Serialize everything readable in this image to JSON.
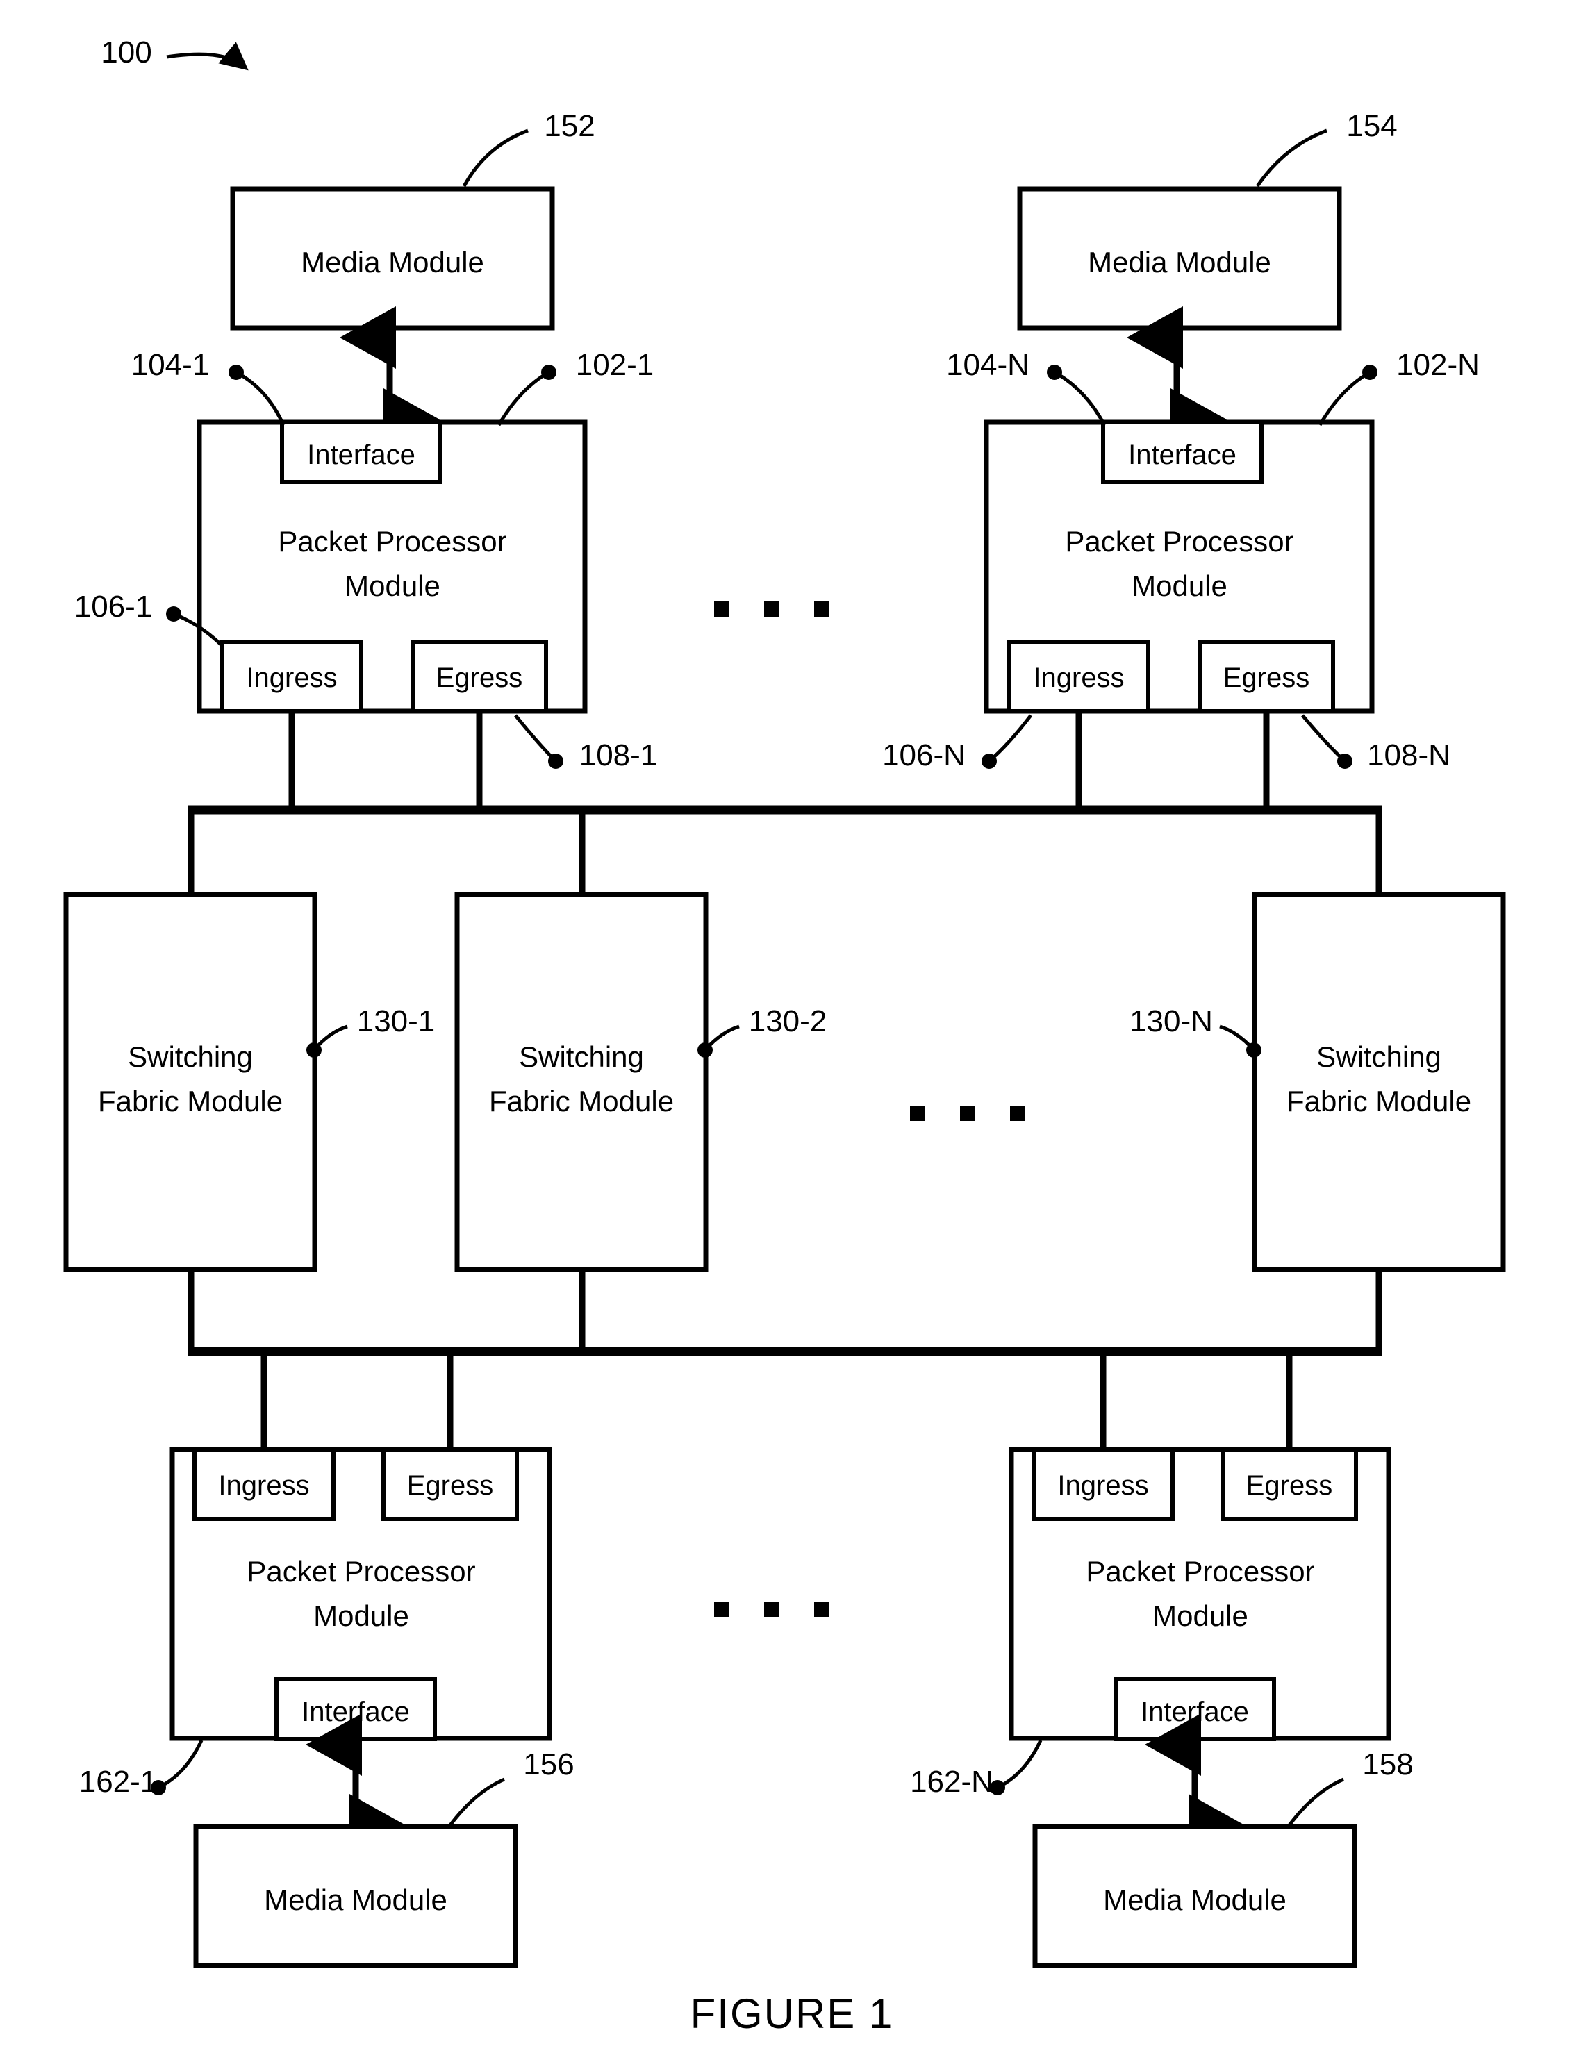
{
  "figure": {
    "caption": "FIGURE 1",
    "system_ref": "100"
  },
  "top_row": {
    "ellipsis": "• • •",
    "columns": [
      {
        "media_module": {
          "label": "Media Module",
          "ref": "152"
        },
        "packet_processor": {
          "label_line1": "Packet Processor",
          "label_line2": "Module",
          "ref": "102-1",
          "interface": {
            "label": "Interface",
            "ref": "104-1"
          },
          "ingress": {
            "label": "Ingress",
            "ref": "106-1"
          },
          "egress": {
            "label": "Egress",
            "ref": "108-1"
          }
        }
      },
      {
        "media_module": {
          "label": "Media Module",
          "ref": "154"
        },
        "packet_processor": {
          "label_line1": "Packet Processor",
          "label_line2": "Module",
          "ref": "102-N",
          "interface": {
            "label": "Interface",
            "ref": "104-N"
          },
          "ingress": {
            "label": "Ingress",
            "ref": "106-N"
          },
          "egress": {
            "label": "Egress",
            "ref": "108-N"
          }
        }
      }
    ]
  },
  "fabric_row": {
    "ellipsis": "• • •",
    "modules": [
      {
        "label_line1": "Switching",
        "label_line2": "Fabric Module",
        "ref": "130-1"
      },
      {
        "label_line1": "Switching",
        "label_line2": "Fabric Module",
        "ref": "130-2"
      },
      {
        "label_line1": "Switching",
        "label_line2": "Fabric Module",
        "ref": "130-N"
      }
    ]
  },
  "bottom_row": {
    "ellipsis": "• • •",
    "columns": [
      {
        "packet_processor": {
          "label_line1": "Packet Processor",
          "label_line2": "Module",
          "ref": "162-1",
          "interface": {
            "label": "Interface"
          },
          "ingress": {
            "label": "Ingress"
          },
          "egress": {
            "label": "Egress"
          }
        },
        "media_module": {
          "label": "Media Module",
          "ref": "156"
        }
      },
      {
        "packet_processor": {
          "label_line1": "Packet Processor",
          "label_line2": "Module",
          "ref": "162-N",
          "interface": {
            "label": "Interface"
          },
          "ingress": {
            "label": "Ingress"
          },
          "egress": {
            "label": "Egress"
          }
        },
        "media_module": {
          "label": "Media Module",
          "ref": "158"
        }
      }
    ]
  }
}
